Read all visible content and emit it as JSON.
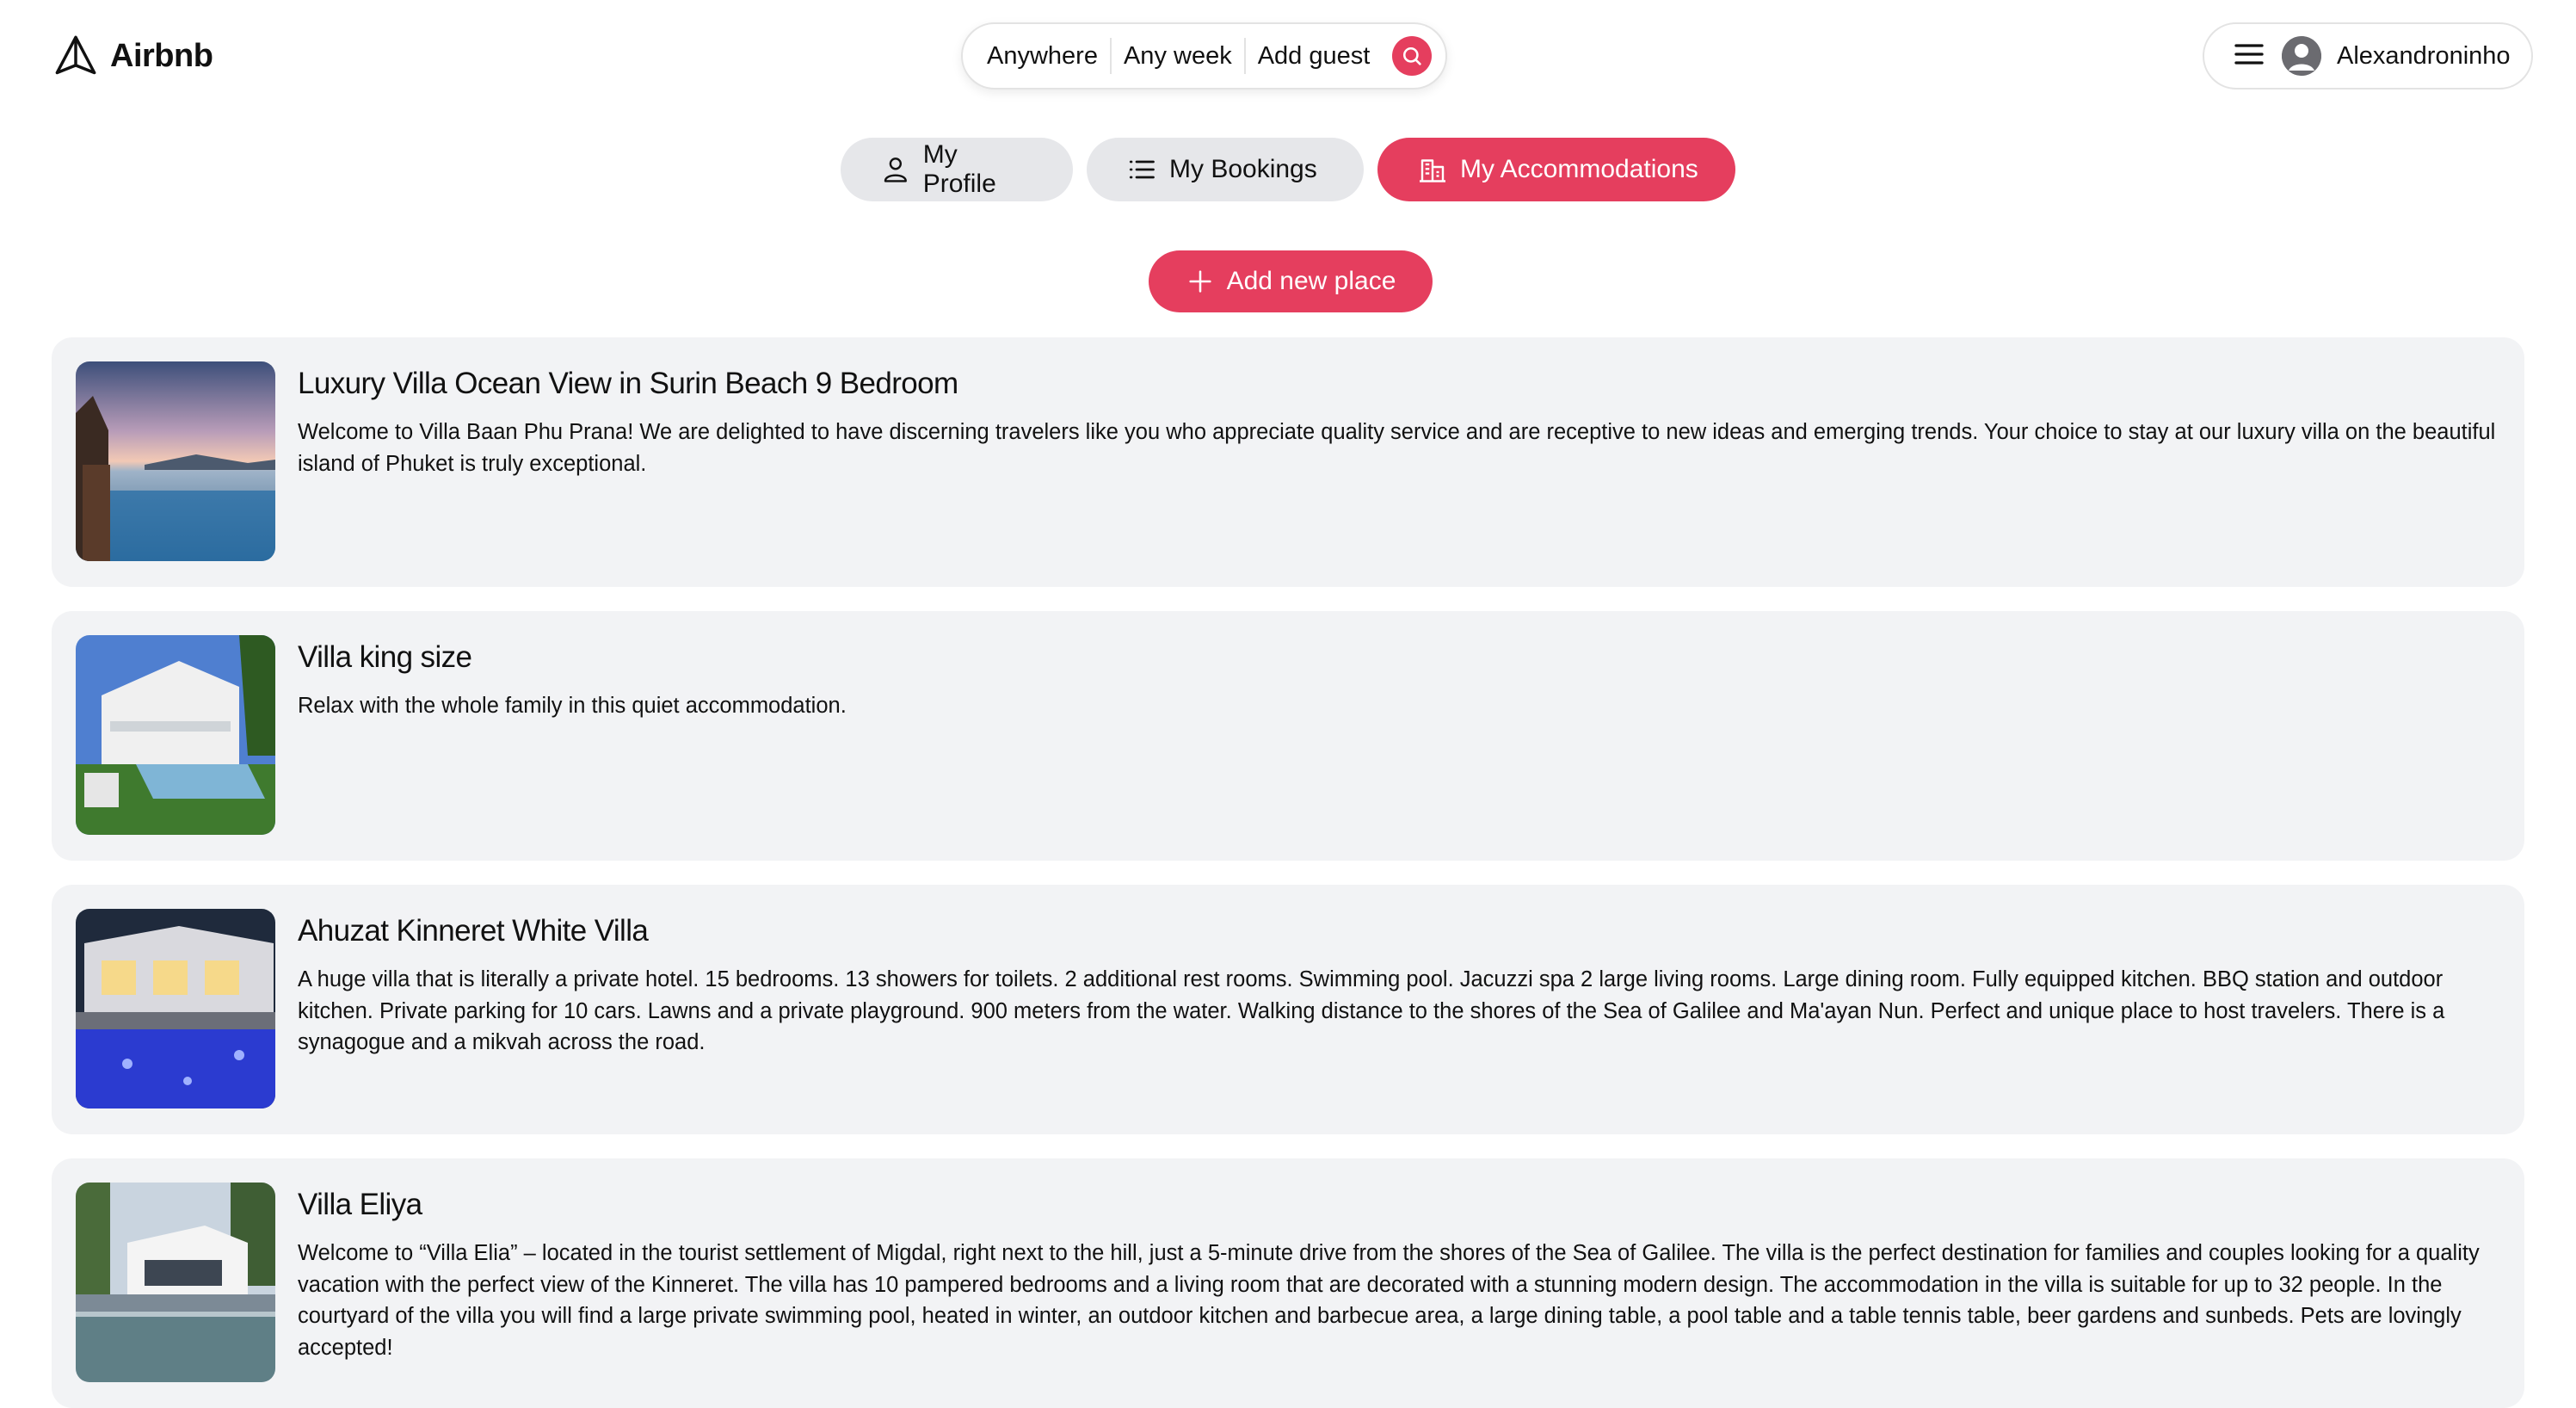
{
  "brand": {
    "name": "Airbnb",
    "color": "#e53e5e"
  },
  "search": {
    "where": "Anywhere",
    "when": "Any week",
    "guests": "Add guest",
    "icon": "search-icon"
  },
  "user": {
    "name": "Alexandroninho",
    "menu_icon": "hamburger-menu-icon",
    "avatar_icon": "user-avatar-icon"
  },
  "tabs": [
    {
      "label": "My Profile",
      "icon": "person-icon",
      "active": false
    },
    {
      "label": "My Bookings",
      "icon": "list-icon",
      "active": false
    },
    {
      "label": "My Accommodations",
      "icon": "building-icon",
      "active": true
    }
  ],
  "add_place": {
    "label": "Add new place",
    "icon": "plus-icon"
  },
  "places": [
    {
      "title": "Luxury Villa Ocean View in Surin Beach 9 Bedroom",
      "description": "Welcome to Villa Baan Phu Prana! We are delighted to have discerning travelers like you who appreciate quality service and are receptive to new ideas and emerging trends. Your choice to stay at our luxury villa on the beautiful island of Phuket is truly exceptional."
    },
    {
      "title": "Villa king size",
      "description": "Relax with the whole family in this quiet accommodation."
    },
    {
      "title": "Ahuzat Kinneret White Villa",
      "description": "A huge villa that is literally a private hotel. 15 bedrooms. 13 showers for toilets. 2 additional rest rooms. Swimming pool. Jacuzzi spa 2 large living rooms. Large dining room. Fully equipped kitchen. BBQ station and outdoor kitchen. Private parking for 10 cars. Lawns and a private playground. 900 meters from the water. Walking distance to the shores of the Sea of Galilee and Ma'ayan Nun. Perfect and unique place to host travelers. There is a synagogue and a mikvah across the road."
    },
    {
      "title": "Villa Eliya",
      "description": "Welcome to “Villa Elia” – located in the tourist settlement of Migdal, right next to the hill, just a 5-minute drive from the shores of the Sea of Galilee. The villa is the perfect destination for families and couples looking for a quality vacation with the perfect view of the Kinneret. The villa has 10 pampered bedrooms and a living room that are decorated with a stunning modern design. The accommodation in the villa is suitable for up to 32 people. In the courtyard of the villa you will find a large private swimming pool, heated in winter, an outdoor kitchen and barbecue area, a large dining table, a pool table and a table tennis table, beer gardens and sunbeds. Pets are lovingly accepted!"
    }
  ]
}
